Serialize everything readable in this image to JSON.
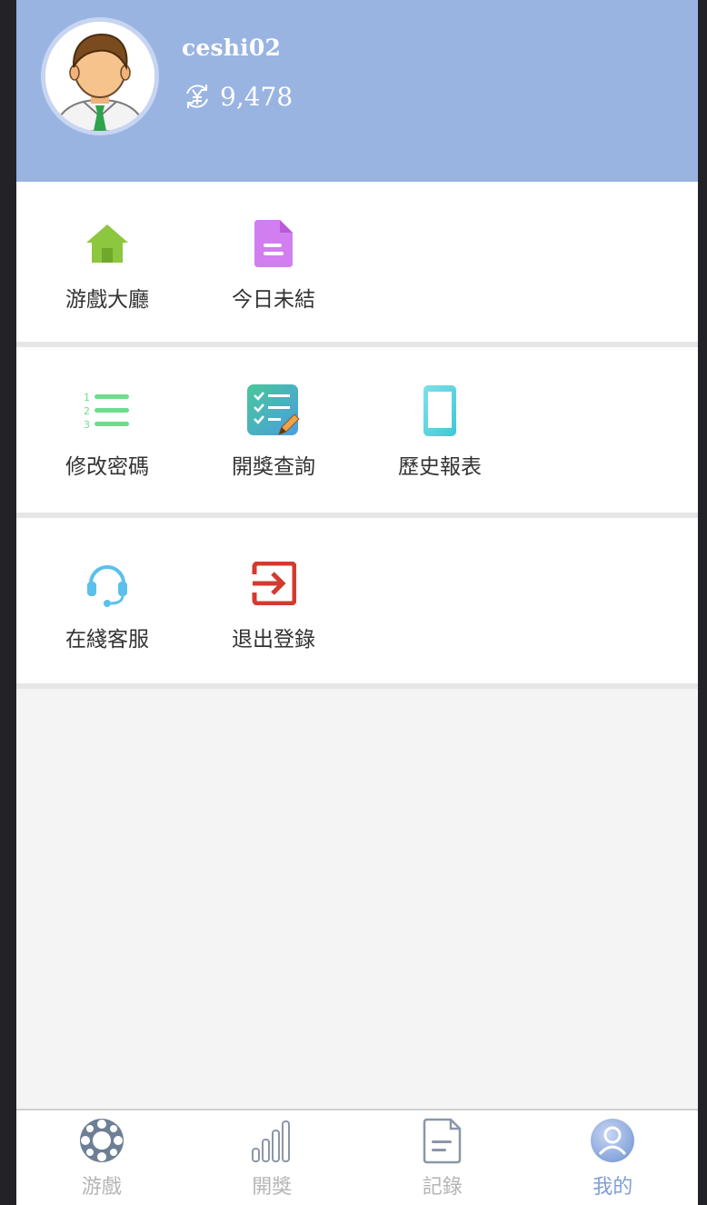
{
  "profile": {
    "username": "ceshi02",
    "balance": "9,478",
    "avatar_icon": "user-avatar-icon",
    "balance_icon": "yuan-exchange-icon"
  },
  "menu": {
    "group1": [
      {
        "label": "游戲大廳",
        "icon": "home-icon",
        "color": "#8dc63f"
      },
      {
        "label": "今日未結",
        "icon": "document-icon",
        "color": "#d17ef0"
      }
    ],
    "group2": [
      {
        "label": "修改密碼",
        "icon": "numbered-list-icon",
        "color": "#6ddd8b"
      },
      {
        "label": "開獎查詢",
        "icon": "checklist-icon",
        "color": "#3fc3b8"
      },
      {
        "label": "歷史報表",
        "icon": "tablet-icon",
        "color": "#4fd3df"
      }
    ],
    "group3": [
      {
        "label": "在綫客服",
        "icon": "headset-icon",
        "color": "#5bc0eb"
      },
      {
        "label": "退出登錄",
        "icon": "logout-icon",
        "color": "#d23b2f"
      }
    ]
  },
  "tabbar": [
    {
      "label": "游戲",
      "icon": "game-wheel-icon",
      "active": false
    },
    {
      "label": "開獎",
      "icon": "bar-chart-icon",
      "active": false
    },
    {
      "label": "記錄",
      "icon": "record-document-icon",
      "active": false
    },
    {
      "label": "我的",
      "icon": "profile-icon",
      "active": true
    }
  ],
  "colors": {
    "header_bg": "#9ab4e2",
    "active_tab": "#7f9fd8",
    "inactive_tab": "#b5b5b5"
  }
}
